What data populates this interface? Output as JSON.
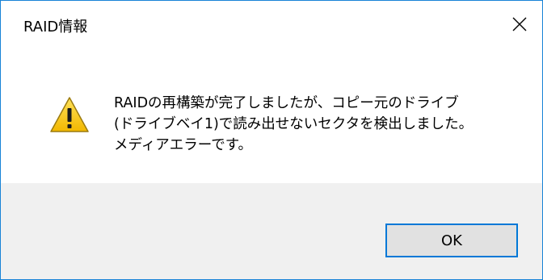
{
  "window": {
    "title": "RAID情報",
    "close_icon": "close-icon"
  },
  "message": {
    "icon": "warning-icon",
    "lines": [
      "RAIDの再構築が完了しましたが、コピー元のドライブ",
      "(ドライブベイ1)で読み出せないセクタを検出しました。",
      "メディアエラーです。"
    ]
  },
  "buttons": {
    "ok_label": "OK"
  },
  "colors": {
    "border": "#1883d7",
    "footer_bg": "#f0f0f0",
    "button_border": "#0078d7",
    "button_bg": "#e1e1e1",
    "warning_yellow": "#f5c400"
  }
}
